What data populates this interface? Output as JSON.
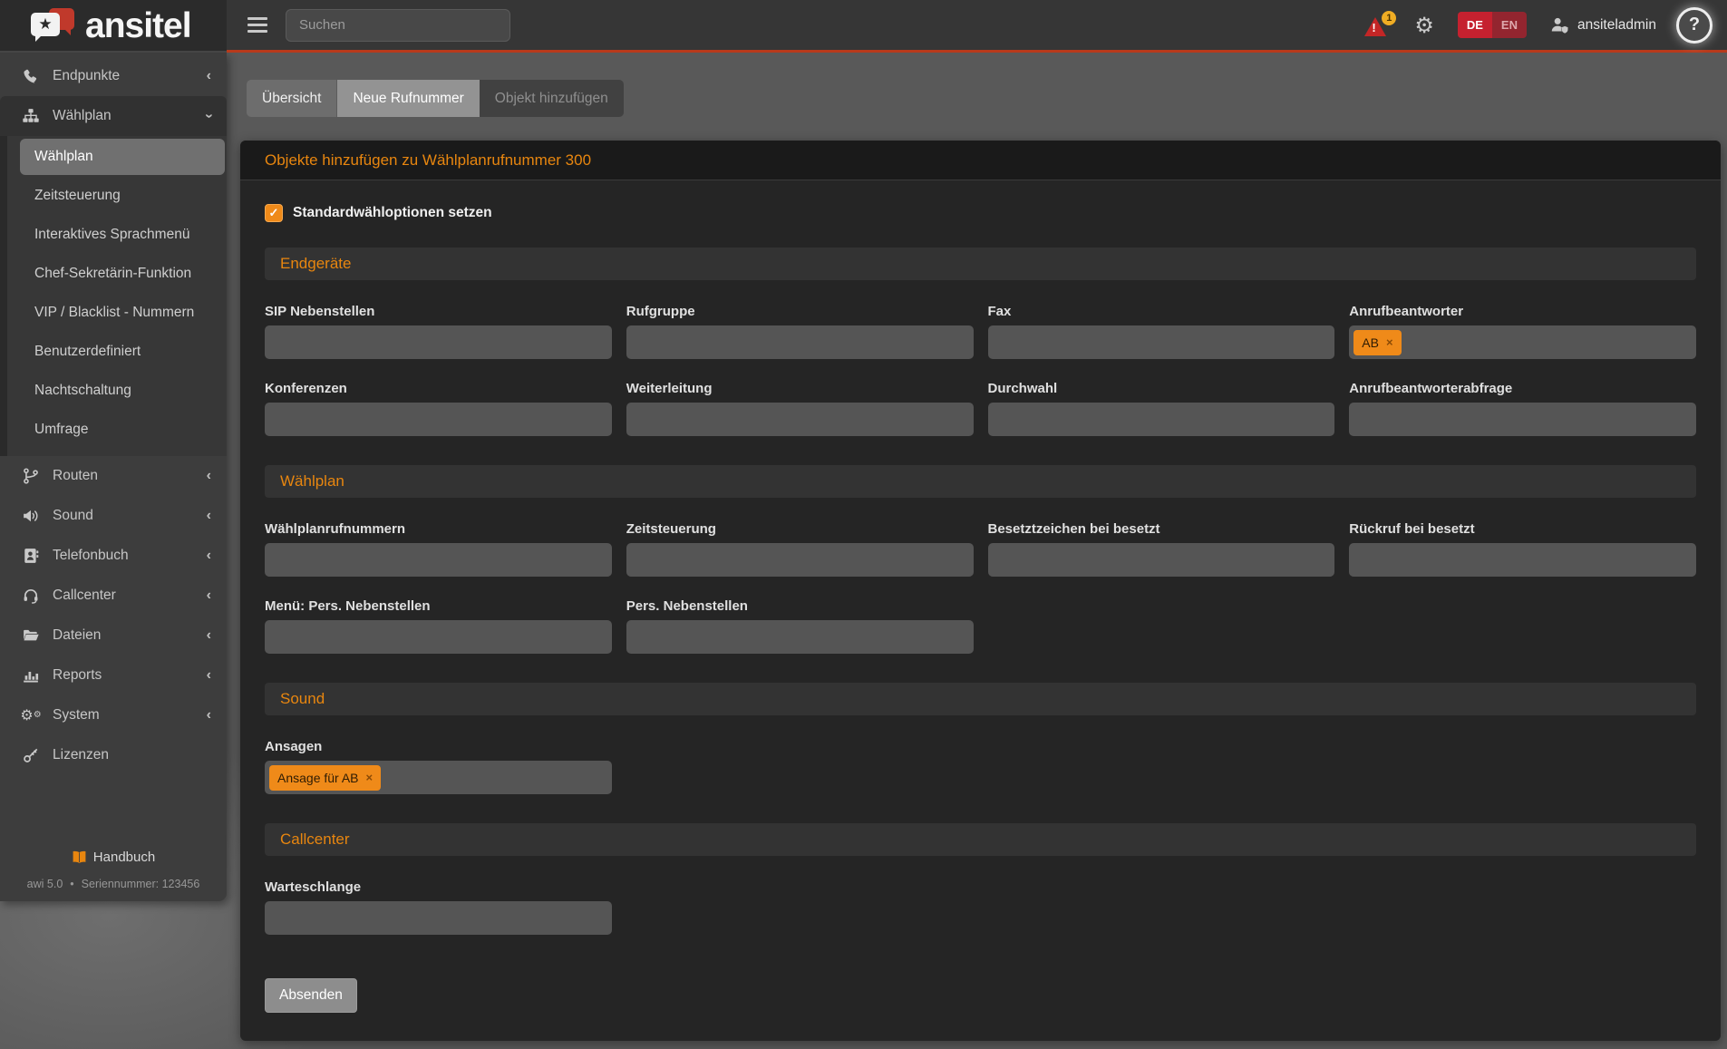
{
  "brand": {
    "name": "ansitel"
  },
  "glyphs": {
    "star": "★",
    "check": "✓",
    "chevron": "‹",
    "remove": "×",
    "gear": "⚙",
    "question": "?",
    "exclamation": "!"
  },
  "colors": {
    "accent_orange": "#ef8a19",
    "section_title_orange": "#e8860f",
    "topbar_rule_red": "#b83a1b",
    "lang_de_bg": "#c5212f",
    "lang_en_bg": "#93252f",
    "logo_bubble_red": "#c0392b"
  },
  "topbar": {
    "search_placeholder": "Suchen",
    "alerts_count": "1",
    "lang_de": "DE",
    "lang_en": "EN",
    "username": "ansiteladmin"
  },
  "sidebar": {
    "items": [
      {
        "label": "Endpunkte",
        "icon": "phone-icon"
      },
      {
        "label": "Wählplan",
        "icon": "sitemap-icon",
        "expanded": true,
        "children": [
          {
            "label": "Wählplan",
            "active": true
          },
          {
            "label": "Zeitsteuerung"
          },
          {
            "label": "Interaktives Sprachmenü"
          },
          {
            "label": "Chef-Sekretärin-Funktion"
          },
          {
            "label": "VIP / Blacklist - Nummern"
          },
          {
            "label": "Benutzerdefiniert"
          },
          {
            "label": "Nachtschaltung"
          },
          {
            "label": "Umfrage"
          }
        ]
      },
      {
        "label": "Routen",
        "icon": "route-branch-icon"
      },
      {
        "label": "Sound",
        "icon": "volume-icon"
      },
      {
        "label": "Telefonbuch",
        "icon": "address-book-icon"
      },
      {
        "label": "Callcenter",
        "icon": "headset-icon"
      },
      {
        "label": "Dateien",
        "icon": "folder-open-icon"
      },
      {
        "label": "Reports",
        "icon": "bar-chart-icon"
      },
      {
        "label": "System",
        "icon": "gears-icon"
      },
      {
        "label": "Lizenzen",
        "icon": "key-icon"
      }
    ],
    "footer": {
      "handbook_label": "Handbuch",
      "version": "awi 5.0",
      "separator": "•",
      "serial": "Seriennummer: 123456"
    }
  },
  "tabs": [
    {
      "label": "Übersicht",
      "state": "normal"
    },
    {
      "label": "Neue Rufnummer",
      "state": "highlighted"
    },
    {
      "label": "Objekt hinzufügen",
      "state": "current"
    }
  ],
  "panel": {
    "title": "Objekte hinzufügen zu Wählplanrufnummer 300",
    "checkbox": {
      "label": "Standardwähloptionen setzen",
      "checked": true
    },
    "sections": [
      {
        "title": "Endgeräte",
        "fields": [
          {
            "label": "SIP Nebenstellen",
            "value": "",
            "tags": []
          },
          {
            "label": "Rufgruppe",
            "value": "",
            "tags": []
          },
          {
            "label": "Fax",
            "value": "",
            "tags": []
          },
          {
            "label": "Anrufbeantworter",
            "value": "",
            "tags": [
              "AB"
            ]
          },
          {
            "label": "Konferenzen",
            "value": "",
            "tags": []
          },
          {
            "label": "Weiterleitung",
            "value": "",
            "tags": []
          },
          {
            "label": "Durchwahl",
            "value": "",
            "tags": []
          },
          {
            "label": "Anrufbeantworterabfrage",
            "value": "",
            "tags": []
          }
        ]
      },
      {
        "title": "Wählplan",
        "fields": [
          {
            "label": "Wählplanrufnummern",
            "value": "",
            "tags": []
          },
          {
            "label": "Zeitsteuerung",
            "value": "",
            "tags": []
          },
          {
            "label": "Besetztzeichen bei besetzt",
            "value": "",
            "tags": []
          },
          {
            "label": "Rückruf bei besetzt",
            "value": "",
            "tags": []
          },
          {
            "label": "Menü: Pers. Nebenstellen",
            "value": "",
            "tags": []
          },
          {
            "label": "Pers. Nebenstellen",
            "value": "",
            "tags": []
          }
        ]
      },
      {
        "title": "Sound",
        "fields": [
          {
            "label": "Ansagen",
            "value": "",
            "tags": [
              "Ansage für AB"
            ]
          }
        ]
      },
      {
        "title": "Callcenter",
        "fields": [
          {
            "label": "Warteschlange",
            "value": "",
            "tags": []
          }
        ]
      }
    ],
    "submit_label": "Absenden"
  }
}
